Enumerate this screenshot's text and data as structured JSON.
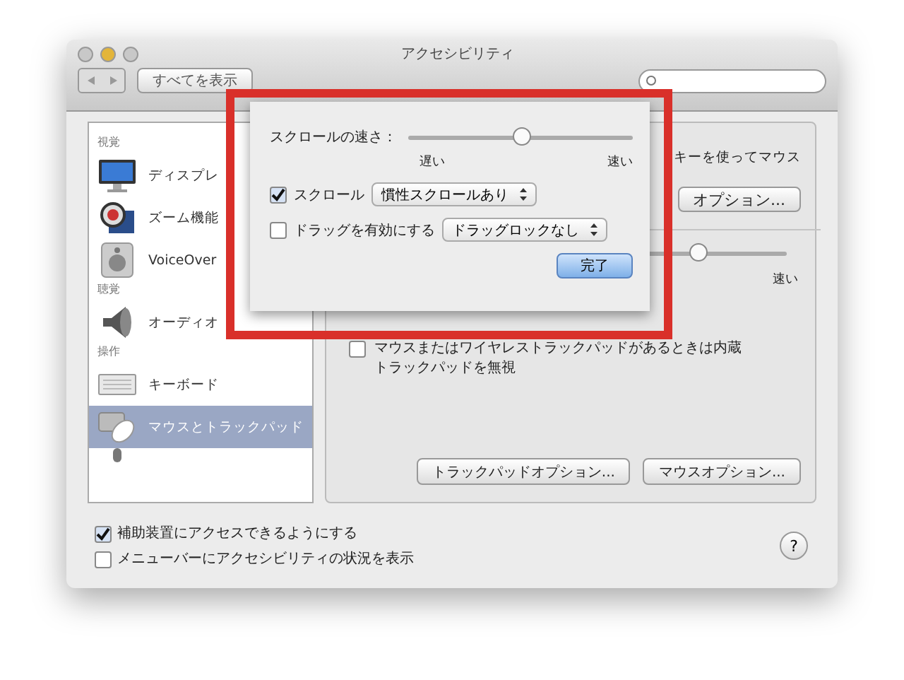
{
  "window": {
    "title": "アクセシビリティ",
    "show_all_button": "すべてを表示"
  },
  "sidebar": {
    "sections": [
      {
        "header": "視覚",
        "items": [
          {
            "label": "ディスプレ",
            "kind": "display",
            "selected": false
          },
          {
            "label": "ズーム機能",
            "kind": "zoom",
            "selected": false
          },
          {
            "label": "VoiceOver",
            "kind": "voiceover",
            "selected": false
          }
        ]
      },
      {
        "header": "聴覚",
        "items": [
          {
            "label": "オーディオ",
            "kind": "speaker",
            "selected": false
          }
        ]
      },
      {
        "header": "操作",
        "items": [
          {
            "label": "キーボード",
            "kind": "keyboard",
            "selected": false
          },
          {
            "label": "マウスとトラックパッド",
            "kind": "mouse",
            "selected": true
          },
          {
            "kind": "microphone",
            "selected": false
          }
        ]
      }
    ]
  },
  "panel": {
    "description": "キーを使ってマウス",
    "options_button": "オプション...",
    "double_click_slider": {
      "level": 0.65,
      "max_label": "速い"
    },
    "ignore_trackpad": {
      "label": "マウスまたはワイヤレストラックパッドがあるときは内蔵トラックパッドを無視",
      "checked": false
    },
    "buttons": [
      "トラックパッドオプション...",
      "マウスオプション..."
    ]
  },
  "options": [
    {
      "label": "補助装置にアクセスできるようにする",
      "checked": true
    },
    {
      "label": "メニューバーにアクセシビリティの状況を表示",
      "checked": false
    }
  ],
  "help_button": "?",
  "sheet": {
    "speed_label": "スクロールの速さ：",
    "speed_slider": {
      "level": 0.5,
      "min_label": "遅い",
      "max_label": "速い"
    },
    "scroll": {
      "label": "スクロール",
      "checked": true,
      "popup": "慣性スクロールあり"
    },
    "drag": {
      "label": "ドラッグを有効にする",
      "checked": false,
      "popup": "ドラッグロックなし"
    },
    "done_button": "完了"
  }
}
